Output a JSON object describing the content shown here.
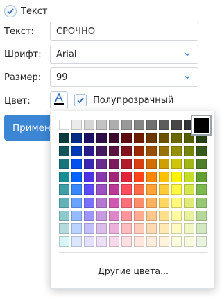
{
  "text_checkbox": {
    "label": "Текст",
    "checked": true
  },
  "form": {
    "text_label": "Текст:",
    "text_value": "СРОЧНО",
    "font_label": "Шрифт:",
    "font_value": "Arial",
    "size_label": "Размер:",
    "size_value": "99",
    "color_label": "Цвет:",
    "translucent_label": "Полупрозрачный",
    "translucent_checked": true
  },
  "apply_button": {
    "label": "Примени"
  },
  "color_picker": {
    "selected_color": "#000000",
    "more_colors_label": "Другие цвета...",
    "palette": [
      [
        "#ffffff",
        "#ebebeb",
        "#d6d6d6",
        "#c2c2c2",
        "#adadad",
        "#999999",
        "#858585",
        "#707070",
        "#5c5c5c",
        "#474747",
        "#333333",
        "#000000"
      ],
      [
        "#0a3b3c",
        "#002c84",
        "#1c1164",
        "#2f0f47",
        "#3c0a2d",
        "#5e0b12",
        "#6f1d01",
        "#6c3700",
        "#6d5200",
        "#6b6800",
        "#535e04",
        "#263f13"
      ],
      [
        "#10555a",
        "#003ab5",
        "#2a1c8c",
        "#46195f",
        "#5a1240",
        "#81131e",
        "#9b2b02",
        "#985000",
        "#987300",
        "#968f00",
        "#748508",
        "#365a1c"
      ],
      [
        "#16767c",
        "#0051f0",
        "#3a28b5",
        "#6a2c8d",
        "#7d1c5c",
        "#b21b2d",
        "#d93f0f",
        "#d16f04",
        "#d09f06",
        "#cec50d",
        "#a2b617",
        "#4e7e2a"
      ],
      [
        "#178d96",
        "#0062ff",
        "#4d33e5",
        "#8638ad",
        "#a02677",
        "#e2233c",
        "#ff4418",
        "#ff8800",
        "#ffc100",
        "#fef300",
        "#c5de29",
        "#62a034"
      ],
      [
        "#3e9fa8",
        "#3a88ff",
        "#5b4bf9",
        "#9c51c3",
        "#bc3997",
        "#ff4c5c",
        "#ff6c48",
        "#ffa336",
        "#ffcc39",
        "#fff742",
        "#d5e64f",
        "#7cba4f"
      ],
      [
        "#62b3b9",
        "#6aa2ff",
        "#7a70fb",
        "#b278d1",
        "#d058b2",
        "#ff6f79",
        "#ff8d6c",
        "#ffb25e",
        "#ffd65e",
        "#fff87a",
        "#e0ec75",
        "#98c873"
      ],
      [
        "#8ec9cd",
        "#94bbff",
        "#9f97fc",
        "#c79be0",
        "#df86c8",
        "#ff959c",
        "#ffac93",
        "#ffc78a",
        "#ffe08a",
        "#fffaa0",
        "#e8f19c",
        "#b6d89a"
      ],
      [
        "#b5dadd",
        "#bbd4ff",
        "#c3befd",
        "#dbbdec",
        "#ebb0db",
        "#ffbcc0",
        "#ffcbba",
        "#ffdab3",
        "#ffeab3",
        "#fffbc3",
        "#f1f6c2",
        "#d3e7c2"
      ],
      [
        "#d7f4f6",
        "#dbe7ff",
        "#e2e0fe",
        "#eddff5",
        "#f6d9ed",
        "#ffdfe1",
        "#ffe6df",
        "#ffeddc",
        "#fff3dc",
        "#fffce0",
        "#f8fadf",
        "#e9f3e0"
      ]
    ]
  }
}
